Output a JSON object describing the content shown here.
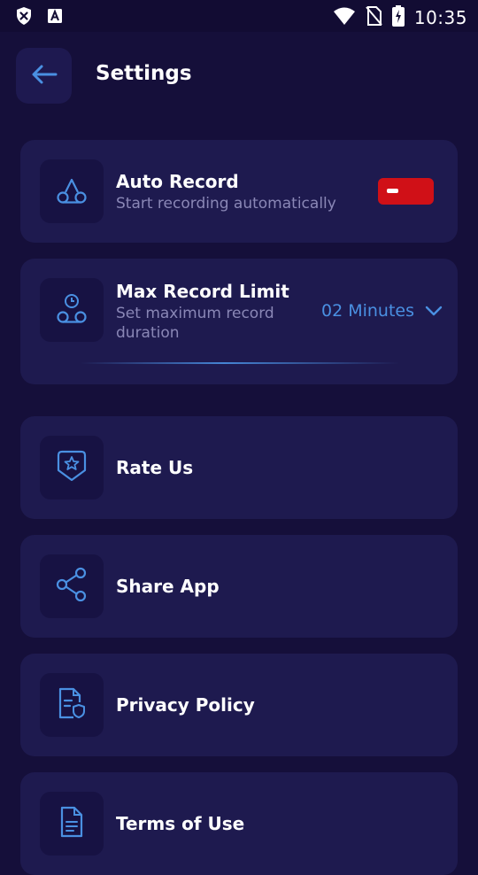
{
  "status_bar": {
    "time": "10:35",
    "icons": [
      "x-shield-icon",
      "font-a-icon",
      "wifi-icon",
      "no-sim-icon",
      "battery-charging-icon"
    ]
  },
  "header": {
    "title": "Settings",
    "back_icon": "arrow-left-icon"
  },
  "settings": {
    "auto_record": {
      "title": "Auto Record",
      "subtitle": "Start recording automatically",
      "toggle_state": "off",
      "toggle_color": "#d01017"
    },
    "max_record_limit": {
      "title": "Max Record Limit",
      "subtitle_line1": "Set maximum record",
      "subtitle_line2": "duration",
      "selected_value": "02 Minutes"
    },
    "rate_us": {
      "title": "Rate Us"
    },
    "share_app": {
      "title": "Share App"
    },
    "privacy_policy": {
      "title": "Privacy Policy"
    },
    "terms_of_use": {
      "title": "Terms of Use"
    }
  },
  "colors": {
    "background": "#150f3a",
    "card": "#1e1a4f",
    "accent": "#4a90e2",
    "toggle_off": "#d01017",
    "subtitle": "#8a87b6"
  }
}
